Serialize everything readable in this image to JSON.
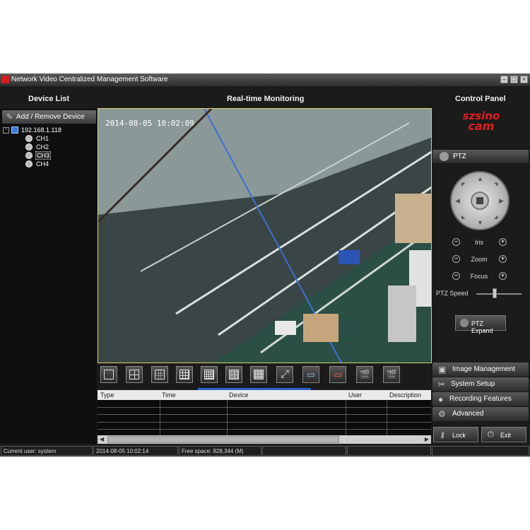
{
  "window": {
    "title": "Network Video Centralized Management Software"
  },
  "headers": {
    "device_list": "Device List",
    "realtime": "Real-time Monitoring",
    "control_panel": "Control Panel"
  },
  "device_panel": {
    "add_remove_label": "Add / Remove Device",
    "device_ip": "192.168.1.118",
    "channels": [
      "CH1",
      "CH2",
      "CH3",
      "CH4"
    ],
    "selected_channel": "CH3"
  },
  "video": {
    "timestamp": "2014-08-05 10:02:09"
  },
  "events_table": {
    "columns": [
      "Type",
      "Time",
      "Device",
      "User",
      "Description"
    ]
  },
  "control_panel": {
    "brand_line1": "szsino",
    "brand_line2": "cam",
    "ptz_tab_label": "PTZ",
    "iris_label": "Iris",
    "zoom_label": "Zoom",
    "focus_label": "Focus",
    "ptz_speed_label": "PTZ Speed",
    "ptz_speed_level": 0.4,
    "ptz_expand_label": "PTZ Expand",
    "menu": [
      "Image Management",
      "System Setup",
      "Recording Features",
      "Advanced"
    ],
    "lock_label": "Lock",
    "exit_label": "Exit",
    "brand_color": "#e21c1c"
  },
  "status_bar": {
    "current_user": "Current user: system",
    "datetime": "2014-08-05 10:02:14",
    "free_space": "Free space: 828,344 (M)"
  }
}
